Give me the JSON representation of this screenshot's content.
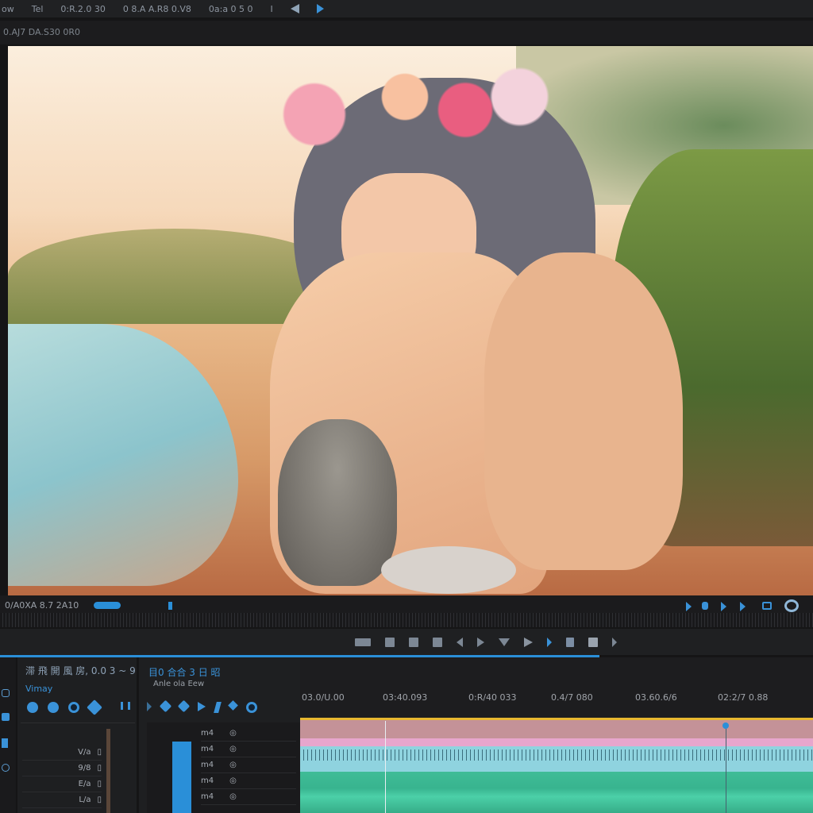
{
  "topbar": {
    "items": [
      "ow",
      "Tel",
      "0:R.2.0 30",
      "0 8.A A.R8 0.V8",
      "0a:a 0 5 0",
      "I"
    ],
    "icons": [
      "rewind-icon",
      "play-icon"
    ]
  },
  "panel": {
    "title": "0.AJ7 DA.S30 0R0"
  },
  "viewer": {
    "description_colors": {
      "sky": "#fbeedd",
      "sea": "#9fd0d6",
      "sand": "#d79a68",
      "grass": "#5d7a3a"
    }
  },
  "controls": {
    "timecode": "0/A0XA 8.7 2A10",
    "accent": "#2a8fd8"
  },
  "transport": {
    "icons": [
      "mark-in-icon",
      "clip-icon",
      "clip-icon",
      "clip-icon",
      "step-back-icon",
      "play-icon",
      "marker-icon",
      "play-icon",
      "next-icon",
      "marker-icon",
      "stop-icon",
      "forward-icon"
    ]
  },
  "left_panel": {
    "title": "滞 飛 開 風 房, 0.0 3 ~ 9",
    "subtitle": "Vimay",
    "rows": [
      "V/a",
      "9/8",
      "E/a",
      "L/a"
    ]
  },
  "mid_panel": {
    "title": "目0 合合 3 日 昭",
    "subtitle": "Anle ola Eew",
    "row_label": "m4"
  },
  "timeline": {
    "ruler": [
      "03.0/U.00",
      "03:40.093",
      "0:R/40 033",
      "0.4/7 080",
      "03.60.6/6",
      "02:2/7 0.88"
    ],
    "colors": {
      "video": "#c49298",
      "pink": "#e7a6cd",
      "audio": "#8fd3df",
      "green": "#3fbc97",
      "marker": "#e8b830"
    }
  }
}
